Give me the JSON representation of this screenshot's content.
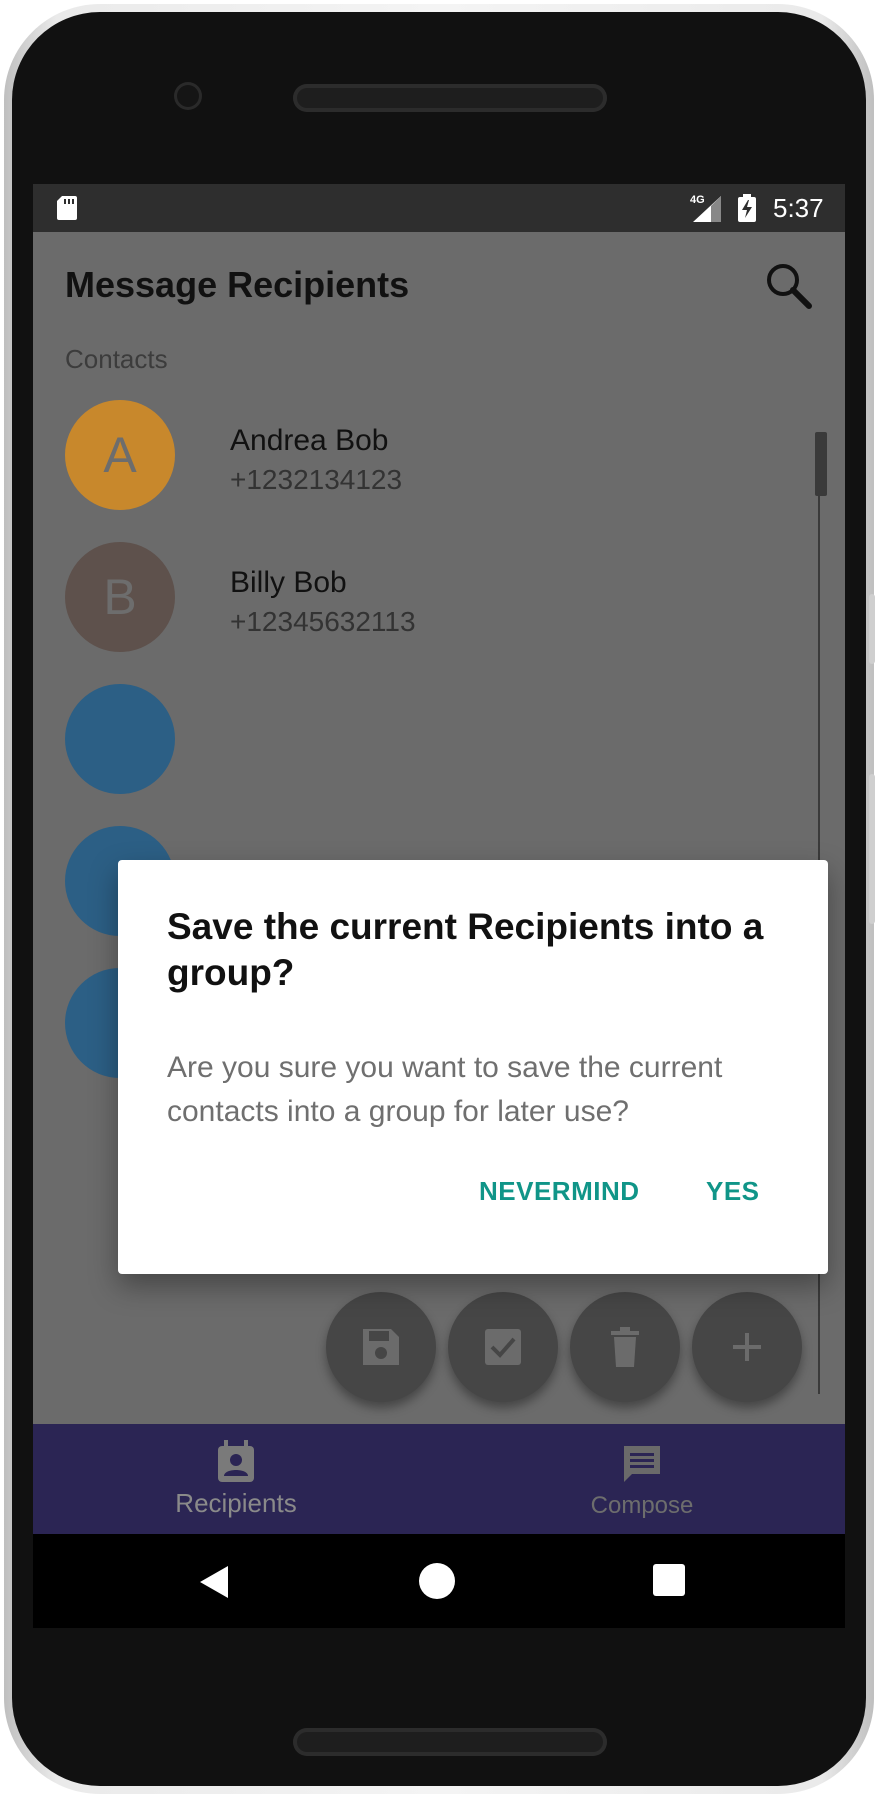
{
  "status_bar": {
    "time": "5:37",
    "network": "4G"
  },
  "app_bar": {
    "title": "Message Recipients"
  },
  "contacts_section": {
    "label": "Contacts"
  },
  "contacts": [
    {
      "initial": "A",
      "name": "Andrea Bob",
      "phone": "+1232134123",
      "color": "#c8882c"
    },
    {
      "initial": "B",
      "name": "Billy Bob",
      "phone": "+12345632113",
      "color": "#5e514c"
    },
    {
      "initial": "",
      "name": "",
      "phone": "",
      "color": "#2c5f85"
    },
    {
      "initial": "",
      "name": "",
      "phone": "",
      "color": "#2c5f85"
    },
    {
      "initial": "",
      "name": "",
      "phone": "",
      "color": "#2c5f85"
    }
  ],
  "dialog": {
    "title": "Save the current Recipients into a group?",
    "message": "Are you sure you want to save the current contacts into a group for later use?",
    "negative_label": "NEVERMIND",
    "positive_label": "YES",
    "accent_color": "#109588"
  },
  "fab_actions": [
    {
      "icon": "save-icon"
    },
    {
      "icon": "checkbox-icon"
    },
    {
      "icon": "trash-icon"
    },
    {
      "icon": "plus-icon"
    }
  ],
  "bottom_nav": {
    "items": [
      {
        "icon": "contact-calendar-icon",
        "label": "Recipients"
      },
      {
        "icon": "message-icon",
        "label": "Compose"
      }
    ],
    "background": "#2b2554"
  }
}
